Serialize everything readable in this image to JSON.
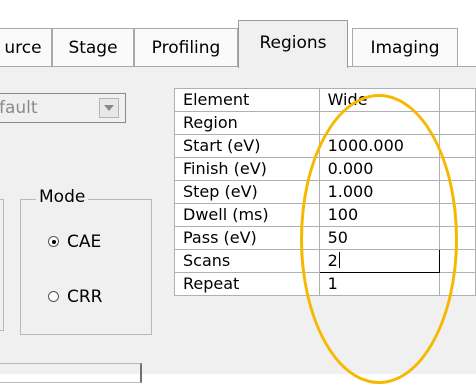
{
  "tabs": [
    {
      "label": "urce",
      "active": false
    },
    {
      "label": "Stage",
      "active": false
    },
    {
      "label": "Profiling",
      "active": false
    },
    {
      "label": "Regions",
      "active": true
    },
    {
      "label": "Imaging",
      "active": false
    }
  ],
  "preset_combo": {
    "value": "fault"
  },
  "mode_group": {
    "title": "Mode",
    "options": [
      {
        "label": "CAE",
        "selected": true
      },
      {
        "label": "CRR",
        "selected": false
      }
    ]
  },
  "region_grid": {
    "header": {
      "label": "Element",
      "value": "Wide"
    },
    "rows": [
      {
        "label": "Region",
        "value": ""
      },
      {
        "label": "Start (eV)",
        "value": "1000.000"
      },
      {
        "label": "Finish (eV)",
        "value": "0.000"
      },
      {
        "label": "Step (eV)",
        "value": "1.000"
      },
      {
        "label": "Dwell (ms)",
        "value": "100"
      },
      {
        "label": "Pass (eV)",
        "value": "50"
      },
      {
        "label": "Scans",
        "value": "2",
        "editing": true
      },
      {
        "label": "Repeat",
        "value": "1"
      }
    ]
  },
  "colors": {
    "highlight_ellipse": "#f6b800",
    "panel_bg": "#f0f0f0"
  }
}
